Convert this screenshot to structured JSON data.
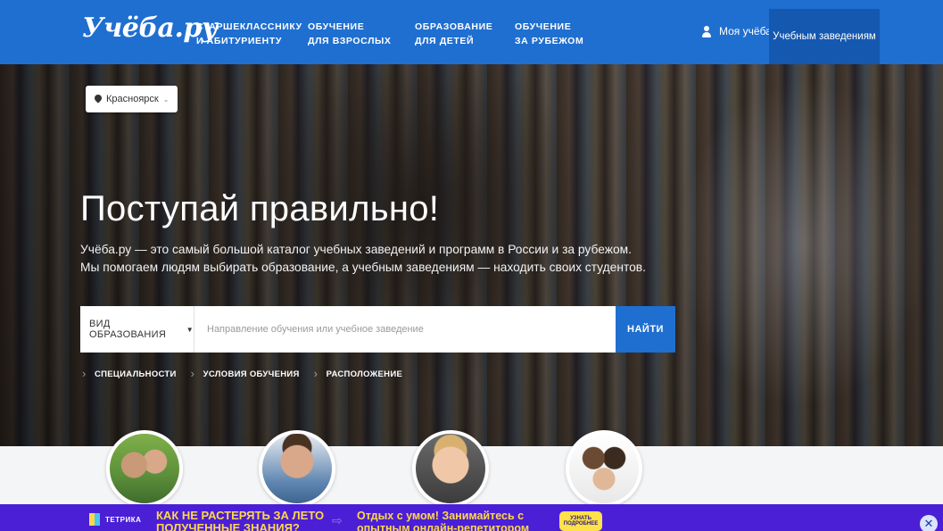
{
  "header": {
    "logo": "Учёба.ру",
    "nav": [
      {
        "label": "СТАРШЕКЛАССНИКУ\nИ АБИТУРИЕНТУ"
      },
      {
        "label": "ОБУЧЕНИЕ\nДЛЯ ВЗРОСЛЫХ"
      },
      {
        "label": "ОБРАЗОВАНИЕ\nДЛЯ ДЕТЕЙ"
      },
      {
        "label": "ОБУЧЕНИЕ\nЗА РУБЕЖОМ"
      }
    ],
    "user_link": "Моя учёба",
    "user_icon": "user-icon",
    "institutions_button": "Учебным заведениям"
  },
  "hero": {
    "city": "Красноярск",
    "title": "Поступай правильно!",
    "description_line1": "Учёба.ру — это самый большой каталог учебных заведений и программ в России и за рубежом.",
    "description_line2": "Мы помогаем людям выбирать образование, а учебным заведениям — находить своих студентов.",
    "search": {
      "type_label": "ВИД ОБРАЗОВАНИЯ",
      "placeholder": "Направление обучения или учебное заведение",
      "button": "НАЙТИ"
    },
    "filters": [
      "СПЕЦИАЛЬНОСТИ",
      "УСЛОВИЯ ОБУЧЕНИЯ",
      "РАСПОЛОЖЕНИЕ"
    ]
  },
  "promo": {
    "brand": "ТЕТРИКА",
    "headline": "КАК НЕ РАСТЕРЯТЬ ЗА ЛЕТО ПОЛУЧЕННЫЕ ЗНАНИЯ?",
    "text": "Отдых с умом! Занимайтесь с опытным онлайн-репетитором",
    "cta": "УЗНАТЬ\nПОДРОБНЕЕ",
    "close_icon": "close-icon"
  },
  "colors": {
    "header_bg": "#1f6fd0",
    "accent_dark": "#1558b0",
    "promo_bg": "#4b1fd6",
    "promo_text": "#ffd84a"
  }
}
